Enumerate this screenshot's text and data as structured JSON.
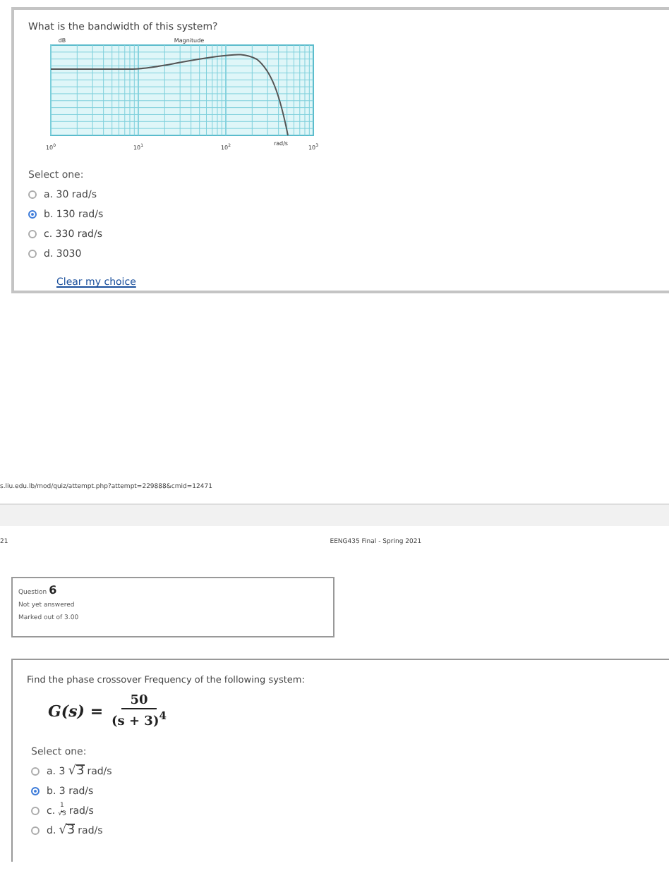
{
  "question_1": {
    "prompt": "What is the bandwidth of this system?",
    "plot": {
      "y_unit": "dB",
      "title": "Magnitude",
      "x_ticks": [
        {
          "base": "10",
          "exponent": "0"
        },
        {
          "base": "10",
          "exponent": "1"
        },
        {
          "base": "10",
          "exponent": "2"
        },
        {
          "base": "10",
          "exponent": "3"
        }
      ],
      "x_unit": "rad/s"
    },
    "select_label": "Select one:",
    "options": [
      {
        "label": "a. 30 rad/s",
        "selected": false
      },
      {
        "label": "b. 130 rad/s",
        "selected": true
      },
      {
        "label": "c. 330 rad/s",
        "selected": false
      },
      {
        "label": "d. 3030",
        "selected": false
      }
    ],
    "clear_link": "Clear my choice"
  },
  "print_footer": {
    "url": "s.liu.edu.lb/mod/quiz/attempt.php?attempt=229888&cmid=12471"
  },
  "print_header": {
    "page_fragment": "21",
    "title": "EENG435 Final - Spring 2021"
  },
  "question_info": {
    "label": "Question",
    "number": "6",
    "status": "Not yet answered",
    "marks": "Marked out of 3.00"
  },
  "question_2": {
    "prompt": "Find the phase crossover Frequency of the following system:",
    "formula": {
      "lhs": "G(s) =",
      "numerator": "50",
      "denominator": "(s + 3)$^{4}$"
    },
    "select_label": "Select one:",
    "options": [
      {
        "kind": "sqrt",
        "prefix": "a. 3",
        "root_sign": "√",
        "radicand": "3",
        "suffix": "rad/s",
        "selected": false
      },
      {
        "kind": "text",
        "label": "b. 3 rad/s",
        "selected": true
      },
      {
        "kind": "fraction",
        "prefix": "c.",
        "numerator": "1",
        "denominator": "√3",
        "suffix": "rad/s",
        "selected": false
      },
      {
        "kind": "sqrt",
        "prefix": "d.",
        "root_sign": "√",
        "radicand": "3",
        "suffix": "rad/s",
        "selected": false
      }
    ]
  }
}
